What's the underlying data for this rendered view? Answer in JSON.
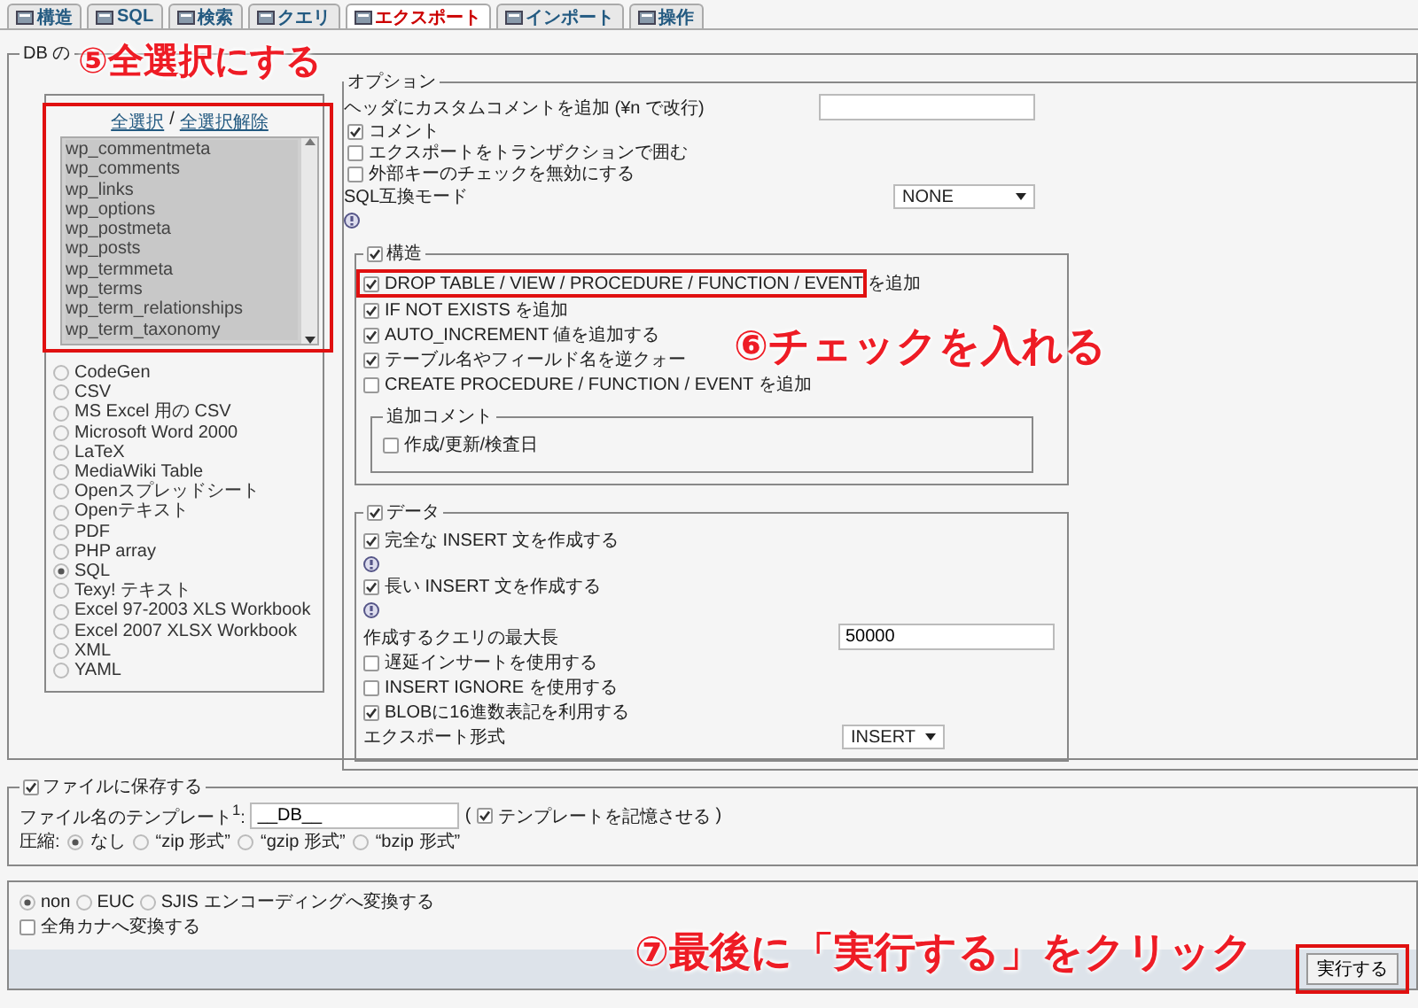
{
  "tabs": [
    {
      "label": "構造",
      "selected": false
    },
    {
      "label": "SQL",
      "selected": false
    },
    {
      "label": "検索",
      "selected": false
    },
    {
      "label": "クエリ",
      "selected": false
    },
    {
      "label": "エクスポート",
      "selected": true
    },
    {
      "label": "インポート",
      "selected": false
    },
    {
      "label": "操作",
      "selected": false
    }
  ],
  "export": {
    "legend": "DB の",
    "tables": {
      "select_all": "全選択",
      "separator": "/",
      "deselect_all": "全選択解除",
      "items": [
        {
          "name": "wp_commentmeta",
          "selected": true
        },
        {
          "name": "wp_comments",
          "selected": true
        },
        {
          "name": "wp_links",
          "selected": true
        },
        {
          "name": "wp_options",
          "selected": true
        },
        {
          "name": "wp_postmeta",
          "selected": true
        },
        {
          "name": "wp_posts",
          "selected": true
        },
        {
          "name": "wp_termmeta",
          "selected": true
        },
        {
          "name": "wp_terms",
          "selected": true
        },
        {
          "name": "wp_term_relationships",
          "selected": true
        },
        {
          "name": "wp_term_taxonomy",
          "selected": true
        }
      ]
    },
    "formats": [
      {
        "label": "CodeGen",
        "selected": false
      },
      {
        "label": "CSV",
        "selected": false
      },
      {
        "label": "MS Excel 用の CSV",
        "selected": false
      },
      {
        "label": "Microsoft Word 2000",
        "selected": false
      },
      {
        "label": "LaTeX",
        "selected": false
      },
      {
        "label": "MediaWiki Table",
        "selected": false
      },
      {
        "label": "Openスプレッドシート",
        "selected": false
      },
      {
        "label": "Openテキスト",
        "selected": false
      },
      {
        "label": "PDF",
        "selected": false
      },
      {
        "label": "PHP array",
        "selected": false
      },
      {
        "label": "SQL",
        "selected": true
      },
      {
        "label": "Texy! テキスト",
        "selected": false
      },
      {
        "label": "Excel 97-2003 XLS Workbook",
        "selected": false
      },
      {
        "label": "Excel 2007 XLSX Workbook",
        "selected": false
      },
      {
        "label": "XML",
        "selected": false
      },
      {
        "label": "YAML",
        "selected": false
      }
    ],
    "options": {
      "legend": "オプション",
      "header_comment_label": "ヘッダにカスタムコメントを追加 (¥n で改行)",
      "checks": [
        {
          "label": "コメント",
          "checked": true
        },
        {
          "label": "エクスポートをトランザクションで囲む",
          "checked": false
        },
        {
          "label": "外部キーのチェックを無効にする",
          "checked": false
        }
      ],
      "compat_label": "SQL互換モード",
      "compat_value": "NONE",
      "structure": {
        "legend": "構造",
        "checked": true,
        "checks": [
          {
            "label": "DROP TABLE / VIEW / PROCEDURE / FUNCTION / EVENT を追加",
            "checked": true
          },
          {
            "label": "IF NOT EXISTS を追加",
            "checked": true
          },
          {
            "label": "AUTO_INCREMENT 値を追加する",
            "checked": true
          },
          {
            "label": "テーブル名やフィールド名を逆クォー",
            "checked": true
          },
          {
            "label": "CREATE PROCEDURE / FUNCTION / EVENT を追加",
            "checked": false
          }
        ],
        "comment_legend": "追加コメント",
        "comment_checks": [
          {
            "label": "作成/更新/検査日",
            "checked": false
          }
        ]
      },
      "data": {
        "legend": "データ",
        "checked": true,
        "rows": [
          {
            "kind": "check",
            "label": "完全な INSERT 文を作成する",
            "checked": true,
            "help": true
          },
          {
            "kind": "check",
            "label": "長い INSERT 文を作成する",
            "checked": true,
            "help": true
          },
          {
            "kind": "input",
            "label": "作成するクエリの最大長",
            "value": "50000"
          },
          {
            "kind": "check",
            "label": "遅延インサートを使用する",
            "checked": false,
            "help": false
          },
          {
            "kind": "check",
            "label": "INSERT IGNORE を使用する",
            "checked": false,
            "help": false
          },
          {
            "kind": "check",
            "label": "BLOBに16進数表記を利用する",
            "checked": true,
            "help": false
          },
          {
            "kind": "select",
            "label": "エクスポート形式",
            "value": "INSERT"
          }
        ]
      }
    }
  },
  "file": {
    "legend": "ファイルに保存する",
    "checked": true,
    "template_label": "ファイル名のテンプレート$^{1}$:",
    "template_value": "__DB__",
    "paren_open": "(",
    "paren_close": ")",
    "remember": {
      "label": "テンプレートを記憶させる",
      "checked": true
    },
    "compression_label": "圧縮:",
    "compression": [
      {
        "label": "なし",
        "selected": true
      },
      {
        "label": "“zip 形式”",
        "selected": false
      },
      {
        "label": "“gzip 形式”",
        "selected": false
      },
      {
        "label": "“bzip 形式”",
        "selected": false
      }
    ]
  },
  "encoding": {
    "options": [
      {
        "label": "non",
        "selected": true
      },
      {
        "label": "EUC",
        "selected": false
      },
      {
        "label": "SJIS",
        "selected": false
      }
    ],
    "suffix": "エンコーディングへ変換する",
    "kana": {
      "label": "全角カナへ変換する",
      "checked": false
    }
  },
  "go_button": "実行する",
  "annotations": [
    {
      "text": "⑤全選択にする"
    },
    {
      "text": "⑥チェックを入れる"
    },
    {
      "text": "⑦最後に「実行する」をクリック"
    }
  ]
}
